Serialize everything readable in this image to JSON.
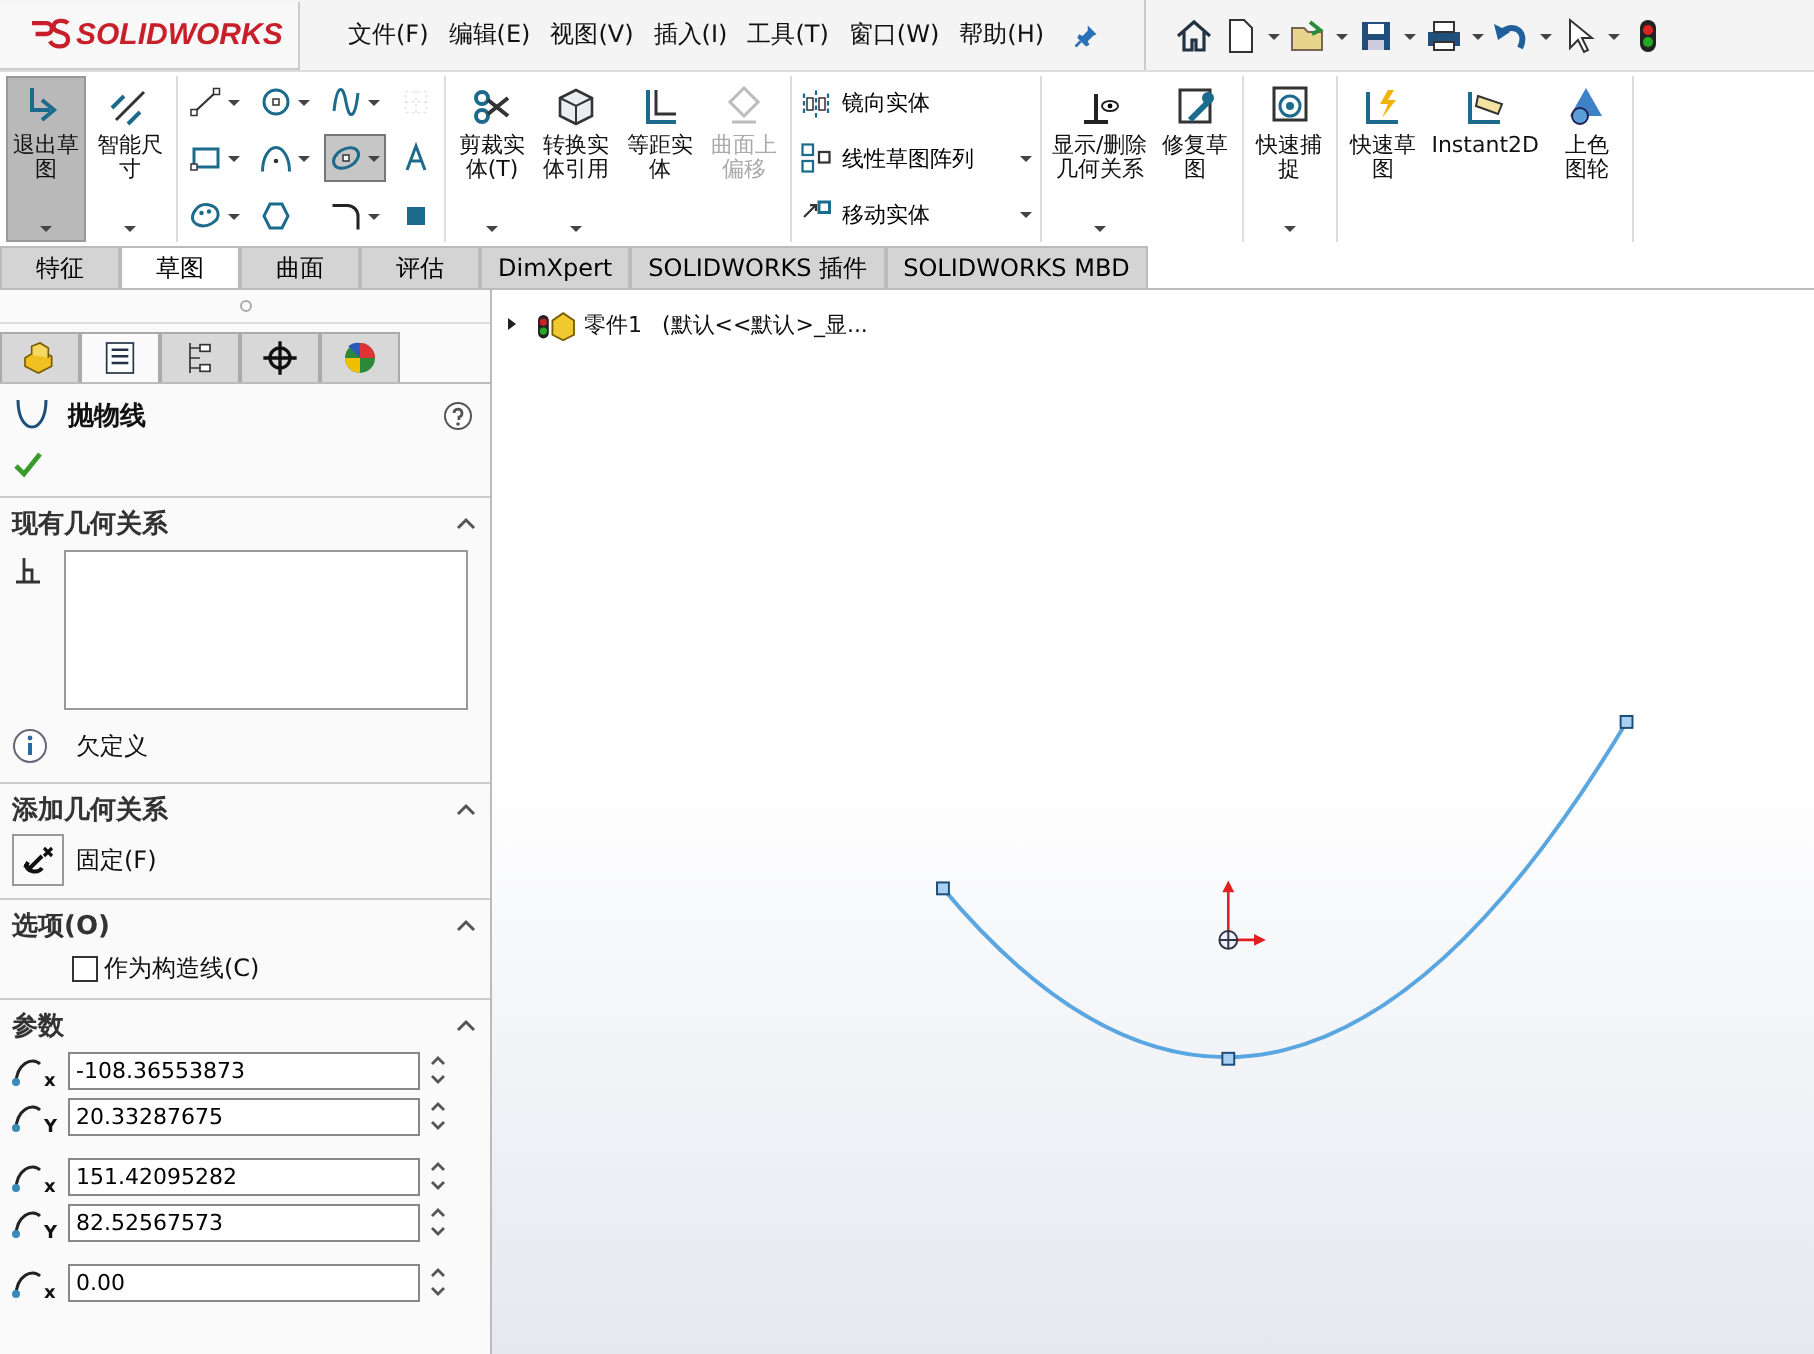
{
  "app": {
    "logo": "SOLIDWORKS"
  },
  "menu": [
    "文件(F)",
    "编辑(E)",
    "视图(V)",
    "插入(I)",
    "工具(T)",
    "窗口(W)",
    "帮助(H)"
  ],
  "ribbon": {
    "groups": [
      {
        "kind": "large",
        "buttons": [
          {
            "lines": [
              "退出草",
              "图"
            ],
            "selected": true,
            "disabled": false,
            "dropdown": true
          },
          {
            "lines": [
              "智能尺",
              "寸"
            ],
            "selected": false,
            "disabled": false,
            "dropdown": true
          }
        ]
      },
      {
        "kind": "tools",
        "tools": [
          {
            "selected": false,
            "disabled": false,
            "dropdown": true
          },
          {
            "selected": false,
            "disabled": false,
            "dropdown": true
          },
          {
            "selected": false,
            "disabled": false,
            "dropdown": true
          },
          {
            "selected": false,
            "disabled": true,
            "dropdown": false
          },
          {
            "selected": false,
            "disabled": false,
            "dropdown": true
          },
          {
            "selected": false,
            "disabled": false,
            "dropdown": true
          },
          {
            "selected": true,
            "disabled": false,
            "dropdown": true
          },
          {
            "selected": false,
            "disabled": false,
            "dropdown": false
          },
          {
            "selected": false,
            "disabled": false,
            "dropdown": true
          },
          {
            "selected": false,
            "disabled": false,
            "dropdown": false
          },
          {
            "selected": false,
            "disabled": false,
            "dropdown": true
          },
          {
            "selected": false,
            "disabled": false,
            "dropdown": false
          }
        ]
      },
      {
        "kind": "large",
        "buttons": [
          {
            "lines": [
              "剪裁实",
              "体(T)"
            ],
            "selected": false,
            "disabled": false,
            "dropdown": true
          },
          {
            "lines": [
              "转换实",
              "体引用"
            ],
            "selected": false,
            "disabled": false,
            "dropdown": true
          },
          {
            "lines": [
              "等距实",
              "体"
            ],
            "selected": false,
            "disabled": false,
            "dropdown": false
          },
          {
            "lines": [
              "曲面上",
              "偏移"
            ],
            "selected": false,
            "disabled": true,
            "dropdown": false
          }
        ]
      },
      {
        "kind": "list",
        "items": [
          {
            "label": "镜向实体",
            "dropdown": false
          },
          {
            "label": "线性草图阵列",
            "dropdown": true
          },
          {
            "label": "移动实体",
            "dropdown": true
          }
        ]
      },
      {
        "kind": "large",
        "buttons": [
          {
            "lines": [
              "显示/删除",
              "几何关系"
            ],
            "selected": false,
            "disabled": false,
            "dropdown": true
          },
          {
            "lines": [
              "修复草",
              "图"
            ],
            "selected": false,
            "disabled": false,
            "dropdown": false
          }
        ]
      },
      {
        "kind": "large",
        "buttons": [
          {
            "lines": [
              "快速捕",
              "捉"
            ],
            "selected": false,
            "disabled": false,
            "dropdown": true
          }
        ]
      },
      {
        "kind": "large",
        "buttons": [
          {
            "lines": [
              "快速草",
              "图"
            ],
            "selected": false,
            "disabled": false,
            "dropdown": false
          },
          {
            "lines": [
              "Instant2D"
            ],
            "selected": false,
            "disabled": false,
            "dropdown": false
          },
          {
            "lines": [
              "上色",
              "图轮"
            ],
            "selected": false,
            "disabled": false,
            "dropdown": false
          }
        ]
      }
    ]
  },
  "tabs": [
    {
      "label": "特征",
      "selected": false
    },
    {
      "label": "草图",
      "selected": true
    },
    {
      "label": "曲面",
      "selected": false
    },
    {
      "label": "评估",
      "selected": false
    },
    {
      "label": "DimXpert",
      "selected": false
    },
    {
      "label": "SOLIDWORKS 插件",
      "selected": false
    },
    {
      "label": "SOLIDWORKS MBD",
      "selected": false
    }
  ],
  "panel": {
    "tabs": [
      {
        "selected": false
      },
      {
        "selected": true
      },
      {
        "selected": false
      },
      {
        "selected": false
      },
      {
        "selected": false
      }
    ],
    "title": "抛物线",
    "sections": [
      {
        "kind": "relations",
        "title": "现有几何关系",
        "status": "欠定义"
      },
      {
        "kind": "add",
        "title": "添加几何关系",
        "button": "固定(F)"
      },
      {
        "kind": "options",
        "title": "选项(O)",
        "checkbox": {
          "label": "作为构造线(C)",
          "checked": false
        }
      },
      {
        "kind": "params",
        "title": "参数",
        "field_groups": [
          [
            {
              "axis": "x",
              "value": "-108.36553873"
            },
            {
              "axis": "Y",
              "value": "20.33287675"
            }
          ],
          [
            {
              "axis": "x",
              "value": "151.42095282"
            },
            {
              "axis": "Y",
              "value": "82.52567573"
            }
          ],
          [
            {
              "axis": "x",
              "value": "0.00"
            }
          ]
        ]
      }
    ]
  },
  "tree": {
    "item": "零件1",
    "config": "(默认<<默认>_显...",
    "expanded": false
  }
}
